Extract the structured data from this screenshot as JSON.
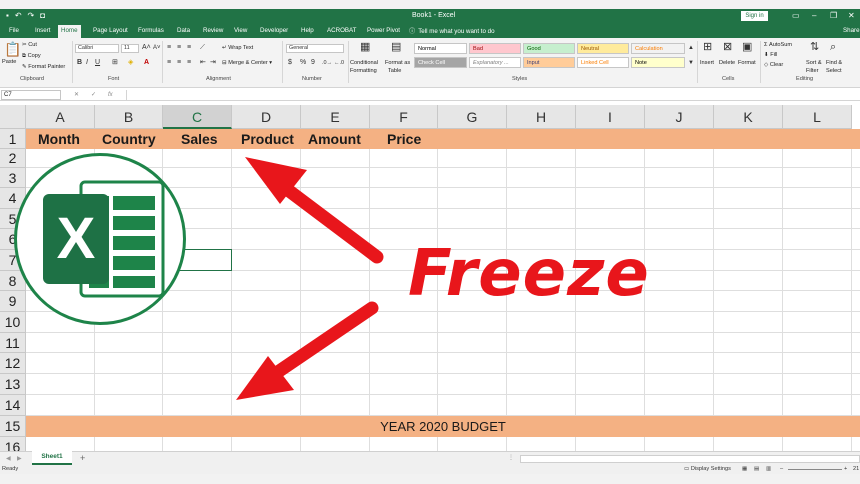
{
  "window": {
    "doc_title": "Book1 - Excel",
    "sign_in": "Sign in",
    "qat_icons": [
      "save-icon",
      "undo-icon",
      "redo-icon",
      "camera-icon"
    ]
  },
  "ribbon": {
    "tabs": [
      "File",
      "Insert",
      "Home",
      "Page Layout",
      "Formulas",
      "Data",
      "Review",
      "View",
      "Developer",
      "Help",
      "ACROBAT",
      "Power Pivot"
    ],
    "active_tab": "Home",
    "tell_me": "Tell me what you want to do",
    "share": "Share",
    "clipboard": {
      "paste": "Paste",
      "cut": "Cut",
      "copy": "Copy",
      "format_painter": "Format Painter",
      "label": "Clipboard"
    },
    "font": {
      "name": "Calibri",
      "size": "11",
      "bold": "B",
      "italic": "I",
      "underline": "U",
      "label": "Font"
    },
    "alignment": {
      "wrap_text": "Wrap Text",
      "merge_center": "Merge & Center",
      "label": "Alignment"
    },
    "number": {
      "format": "General",
      "currency": "$",
      "percent": "%",
      "comma": "9",
      "label": "Number"
    },
    "styles": {
      "conditional": [
        "Conditional",
        "Formatting"
      ],
      "format_as_table": [
        "Format as",
        "Table"
      ],
      "cells": [
        {
          "label": "Normal",
          "bg": "#ffffff",
          "fg": "#000000"
        },
        {
          "label": "Bad",
          "bg": "#ffc7ce",
          "fg": "#9c0006"
        },
        {
          "label": "Good",
          "bg": "#c6efce",
          "fg": "#006100"
        },
        {
          "label": "Neutral",
          "bg": "#ffeb9c",
          "fg": "#9c5700"
        },
        {
          "label": "Calculation",
          "bg": "#f2f2f2",
          "fg": "#fa7d00"
        },
        {
          "label": "Check Cell",
          "bg": "#a5a5a5",
          "fg": "#ffffff"
        },
        {
          "label": "Explanatory ...",
          "bg": "#ffffff",
          "fg": "#7f7f7f"
        },
        {
          "label": "Input",
          "bg": "#ffcc99",
          "fg": "#3f3f76"
        },
        {
          "label": "Linked Cell",
          "bg": "#ffffff",
          "fg": "#fa7d00"
        },
        {
          "label": "Note",
          "bg": "#ffffcc",
          "fg": "#000000"
        }
      ],
      "label": "Styles"
    },
    "cells_group": {
      "insert": "Insert",
      "delete": "Delete",
      "format": "Format",
      "label": "Cells"
    },
    "editing": {
      "autosum": "AutoSum",
      "fill": "Fill",
      "clear": "Clear",
      "sort_filter": [
        "Sort &",
        "Filter"
      ],
      "find_select": [
        "Find &",
        "Select"
      ],
      "label": "Editing"
    }
  },
  "formula_bar": {
    "name_box": "C7",
    "cancel": "✕",
    "enter": "✓",
    "fx": "fx",
    "value": ""
  },
  "sheet": {
    "columns": [
      "A",
      "B",
      "C",
      "D",
      "E",
      "F",
      "G",
      "H",
      "I",
      "J",
      "K",
      "L"
    ],
    "selected_column": "C",
    "rows": [
      "1",
      "2",
      "3",
      "4",
      "5",
      "6",
      "7",
      "8",
      "9",
      "10",
      "11",
      "12",
      "13",
      "14",
      "15",
      "16"
    ],
    "header_cells": [
      "Month",
      "Country",
      "Sales",
      "Product",
      "Amount",
      "Price"
    ],
    "banner": "YEAR 2020 BUDGET",
    "band_color": "#f4b183"
  },
  "overlay": {
    "logo_letter": "X",
    "freeze_text": "Freeze",
    "accent": "#e8161b",
    "excel_green": "#1e8449"
  },
  "sheet_tabs": {
    "active": "Sheet1",
    "add": "+"
  },
  "status": {
    "ready": "Ready",
    "display_settings": "Display Settings",
    "zoom": "21"
  }
}
